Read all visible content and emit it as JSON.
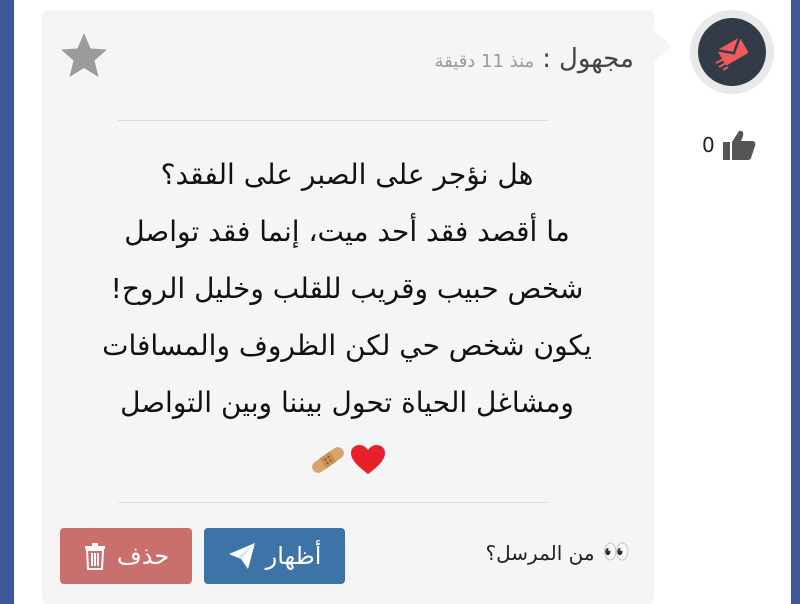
{
  "post": {
    "author": "مجهول",
    "separator": ":",
    "time_ago": "منذ 11 دقيقة",
    "message_lines": [
      "هل نؤجر على الصبر على الفقد؟",
      "ما أقصد فقد أحد ميت، إنما فقد تواصل",
      "شخص حبيب وقريب للقلب وخليل الروح!",
      "يكون شخص حي لكن الظروف والمسافات",
      "ومشاغل الحياة تحول بيننا وبين التواصل"
    ],
    "emoji_line": "❤🩹",
    "likes_count": "0"
  },
  "actions": {
    "show_label": "أظهار",
    "delete_label": "حذف",
    "sender_question": "من المرسل؟",
    "sender_emoji": "👀"
  },
  "colors": {
    "frame": "#3b5998",
    "card_bg": "#f5f5f5",
    "show_button": "#3d73a6",
    "delete_button": "#c9706f",
    "avatar_bg": "#333b48",
    "avatar_icon": "#f05a5a"
  },
  "icons": {
    "favorite": "star-icon",
    "like": "thumbs-up-icon",
    "avatar": "envelope-icon",
    "show": "paper-plane-icon",
    "delete": "trash-icon"
  }
}
